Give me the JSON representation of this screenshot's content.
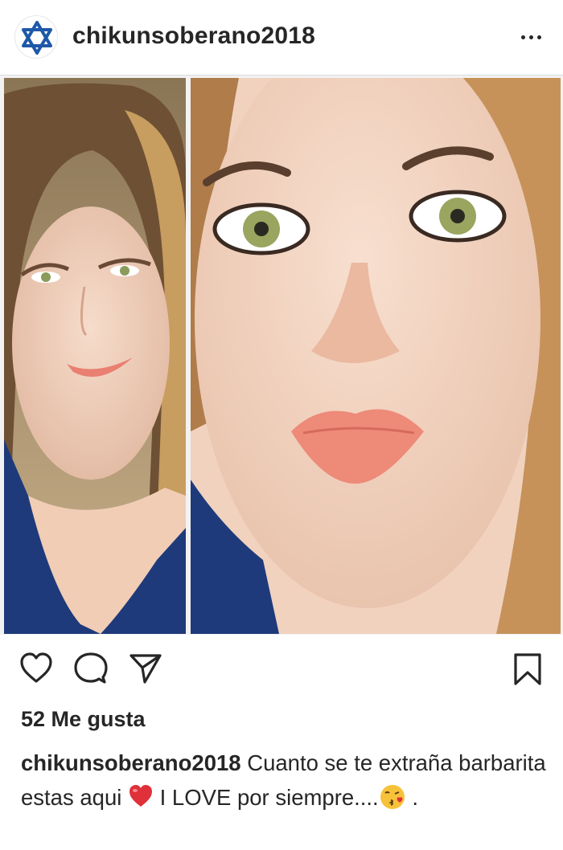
{
  "post": {
    "username": "chikunsoberano2018",
    "avatar_icon": "star-of-david-icon",
    "menu_icon": "more-options-icon"
  },
  "photo": {
    "description_icons": [
      "face-portrait-left",
      "face-portrait-right"
    ]
  },
  "actions": {
    "like_icon": "heart-outline-icon",
    "comment_icon": "comment-bubble-icon",
    "share_icon": "paper-plane-icon",
    "save_icon": "bookmark-icon"
  },
  "likes": {
    "text": "52 Me gusta"
  },
  "caption": {
    "username": "chikunsoberano2018",
    "text_part1": " Cuanto se te extraña barbarita estas aqui ",
    "text_part2": " I LOVE por siempre....",
    "text_part3": " ."
  },
  "colors": {
    "text": "#262626",
    "divider": "#dbdbdb",
    "star_blue": "#1e58a8",
    "heart_red": "#e0303a"
  }
}
